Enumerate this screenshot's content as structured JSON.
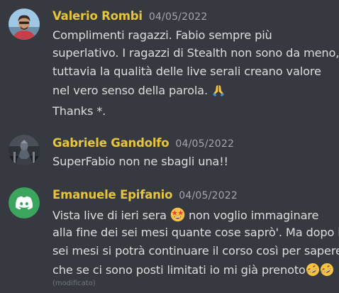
{
  "messages": [
    {
      "author": "Valerio Rombi",
      "timestamp": "04/05/2022",
      "lines": [
        "Complimenti ragazzi. Fabio sempre più",
        "superlativo. I ragazzi di Stealth non sono da meno,",
        "tuttavia la qualità delle live serali    creano valore",
        "nel vero senso della parola.",
        "Thanks *."
      ],
      "emoji": "folded-hands"
    },
    {
      "author": "Gabriele Gandolfo",
      "timestamp": "04/05/2022",
      "lines": [
        "SuperFabio non ne sbagli una!!"
      ]
    },
    {
      "author": "Emanuele Epifanio",
      "timestamp": "04/05/2022",
      "lines": [
        "Vista live di ieri sera",
        "non voglio immaginare",
        "alla fine dei sei mesi quante cose saprò'. Ma dopo i",
        "sei mesi si potrà continuare il corso così per sapere",
        "che se ci sono posti limitati io mi già prenoto"
      ],
      "edited_label": "(modificato)"
    }
  ],
  "colors": {
    "background": "#36393f",
    "author": "#e7c53a",
    "timestamp": "#a3a6aa",
    "text": "#dcddde",
    "discord_avatar": "#3ba55d"
  }
}
